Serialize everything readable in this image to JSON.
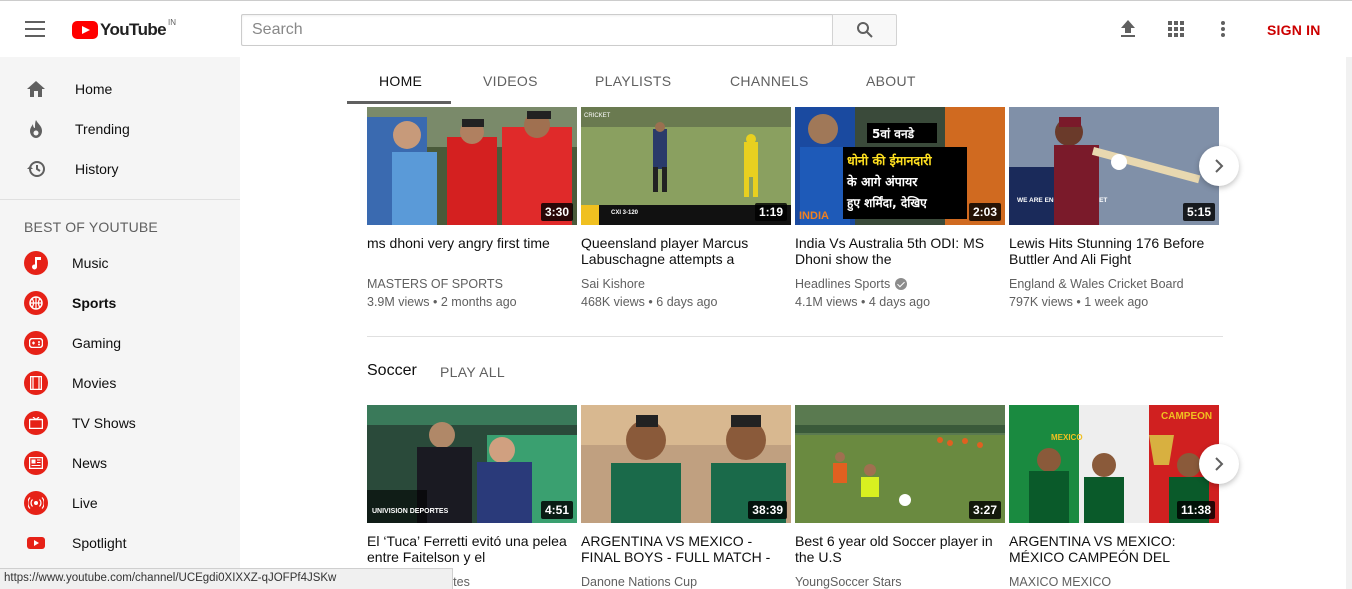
{
  "header": {
    "logo_text": "YouTube",
    "logo_region": "IN",
    "search_placeholder": "Search",
    "sign_in_label": "SIGN IN"
  },
  "sidebar": {
    "main_items": [
      {
        "label": "Home",
        "icon": "home-icon"
      },
      {
        "label": "Trending",
        "icon": "fire-icon"
      },
      {
        "label": "History",
        "icon": "history-icon"
      }
    ],
    "section_title": "BEST OF YOUTUBE",
    "categories": [
      {
        "label": "Music",
        "icon": "music-note-icon"
      },
      {
        "label": "Sports",
        "icon": "basketball-icon",
        "active": true
      },
      {
        "label": "Gaming",
        "icon": "gamepad-icon"
      },
      {
        "label": "Movies",
        "icon": "film-icon"
      },
      {
        "label": "TV Shows",
        "icon": "tv-icon"
      },
      {
        "label": "News",
        "icon": "newspaper-icon"
      },
      {
        "label": "Live",
        "icon": "broadcast-icon"
      },
      {
        "label": "Spotlight",
        "icon": "youtube-play-icon"
      }
    ]
  },
  "tabs": [
    {
      "label": "HOME",
      "active": true
    },
    {
      "label": "VIDEOS"
    },
    {
      "label": "PLAYLISTS"
    },
    {
      "label": "CHANNELS"
    },
    {
      "label": "ABOUT"
    }
  ],
  "shelf1": {
    "videos": [
      {
        "title": "ms dhoni very angry first time",
        "channel": "MASTERS OF SPORTS",
        "views": "3.9M views",
        "age": "2 months ago",
        "duration": "3:30"
      },
      {
        "title": "Queensland player Marcus Labuschagne attempts a",
        "channel": "Sai Kishore",
        "views": "468K views",
        "age": "6 days ago",
        "duration": "1:19"
      },
      {
        "title": "India Vs Australia 5th ODI: MS Dhoni show the",
        "channel": "Headlines Sports",
        "views": "4.1M views",
        "age": "4 days ago",
        "duration": "2:03",
        "verified": true
      },
      {
        "title": "Lewis Hits Stunning 176 Before Buttler And Ali Fight",
        "channel": "England & Wales Cricket Board",
        "views": "797K views",
        "age": "1 week ago",
        "duration": "5:15"
      }
    ]
  },
  "shelf2": {
    "title": "Soccer",
    "play_all_label": "PLAY ALL",
    "videos": [
      {
        "title": "El ‘Tuca’ Ferretti evitó una pelea entre Faitelson y el",
        "channel": "rtes",
        "duration": "4:51"
      },
      {
        "title": "ARGENTINA VS MEXICO - FINAL BOYS - FULL MATCH -",
        "channel": "Danone Nations Cup",
        "duration": "38:39"
      },
      {
        "title": "Best 6 year old Soccer player in the U.S",
        "channel": "YoungSoccer Stars",
        "duration": "3:27"
      },
      {
        "title": "ARGENTINA VS MEXICO: MÉXICO CAMPEÓN DEL",
        "channel": "MAXICO MEXICO",
        "duration": "11:38"
      }
    ]
  },
  "thumb_text": {
    "t3_line1": "5वां वनडे",
    "t3_line2": "धोनी की ईमानदारी",
    "t3_line3": "के आगे अंपायर",
    "t3_line4": "हुए शर्मिंदा, देखिए",
    "t3_logo": "INDIA",
    "t4_logo": "WE ARE ENGLAND CRICKET",
    "t5_logo": "UNIVISION DEPORTES",
    "t8_banner": "CAMPEON",
    "t8_flag": "MEXICO",
    "t2_logo": "CRICKET",
    "t2_score": "CXI 3-120"
  },
  "status_bar": {
    "url": "https://www.youtube.com/channel/UCEgdi0XIXXZ-qJOFPf4JSKw"
  },
  "colors": {
    "brand_red": "#ff0000",
    "sign_in_red": "#cc0000",
    "sidebar_bg": "#f5f5f5"
  }
}
